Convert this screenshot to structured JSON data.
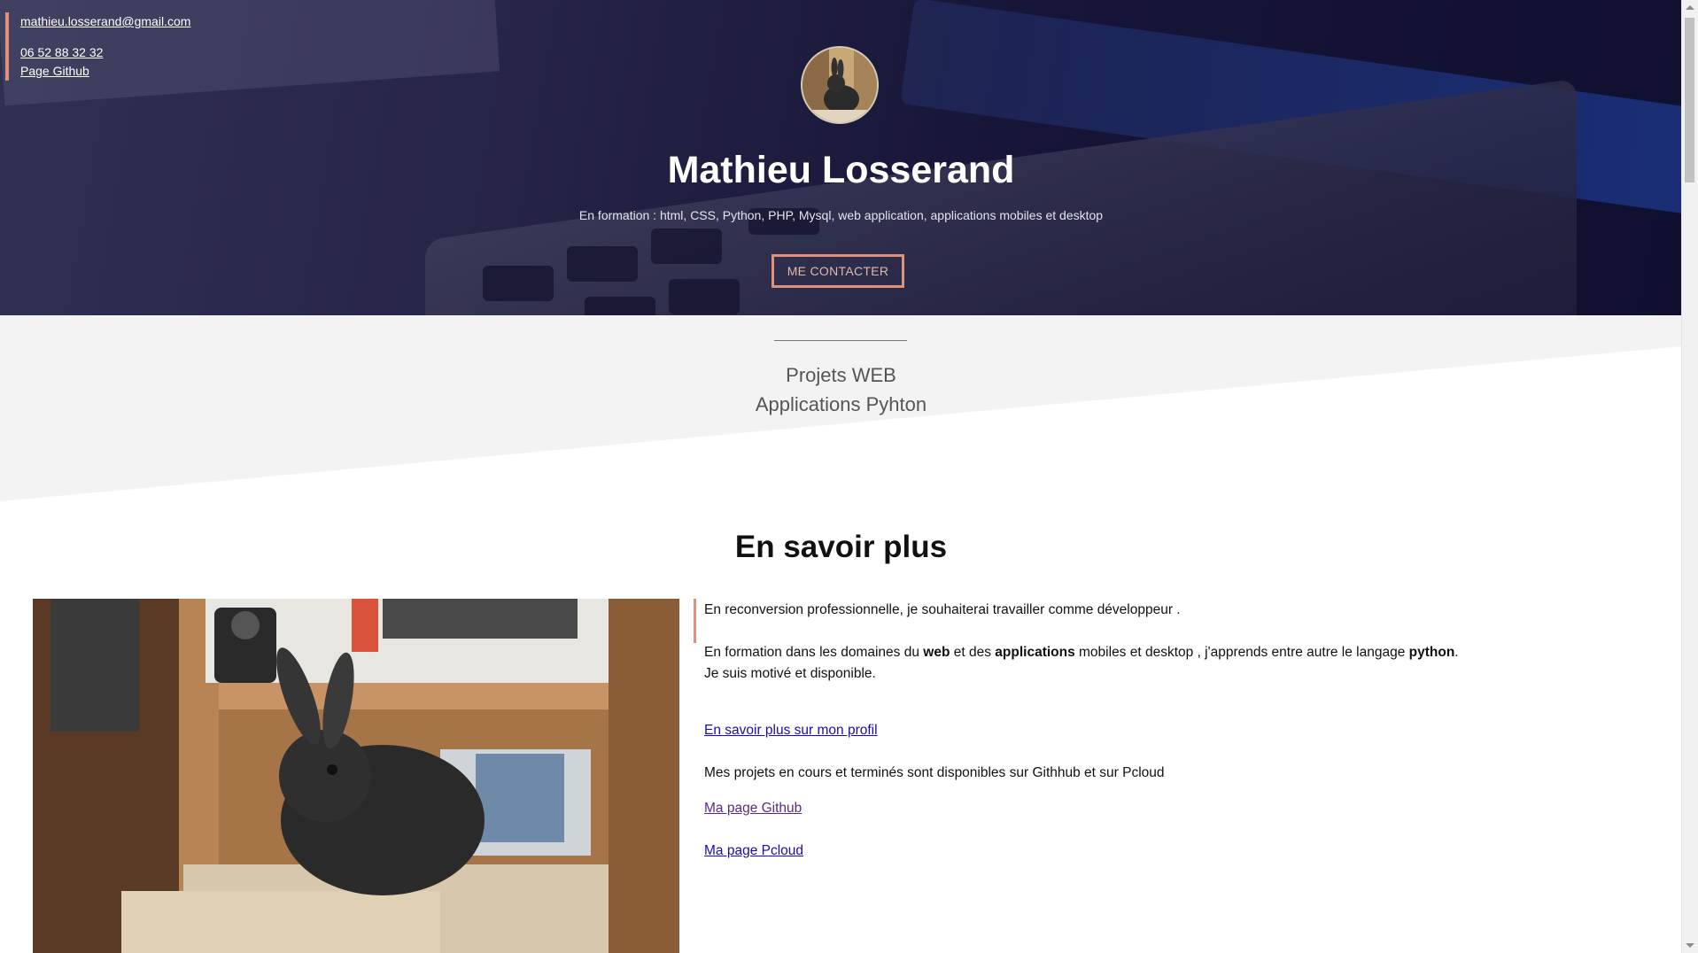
{
  "contact": {
    "email": "mathieu.losserand@gmail.com",
    "phone": "06 52 88 32 32",
    "github": "Page Github"
  },
  "hero": {
    "name": "Mathieu Losserand",
    "subtitle": "En formation : html, CSS, Python, PHP, Mysql, web application, applications mobiles et desktop",
    "cta_label": "ME CONTACTER"
  },
  "projects": {
    "items": [
      "Projets WEB",
      "Applications Pyhton"
    ]
  },
  "about": {
    "title": "En savoir plus",
    "intro": "En reconversion professionnelle, je souhaiterai travailler comme développeur .",
    "training_pre": "En formation dans les domaines du ",
    "training_web": "web",
    "training_mid": " et des ",
    "training_apps": "applications",
    "training_post": " mobiles et desktop , j'apprends entre autre le langage ",
    "training_python": "python",
    "training_end": ".",
    "motivated": "Je suis motivé et disponible.",
    "profile_link": "En savoir plus sur mon profil",
    "projects_text": "Mes projets en cours et terminés sont disponibles sur Githhub et sur Pcloud",
    "github_link": "Ma page Github",
    "pcloud_link": "Ma page Pcloud"
  },
  "colors": {
    "accent": "#e0917b",
    "hero_bg": "#1a1a3a",
    "link": "#1a0dab",
    "visited_link": "#5a2a86"
  }
}
